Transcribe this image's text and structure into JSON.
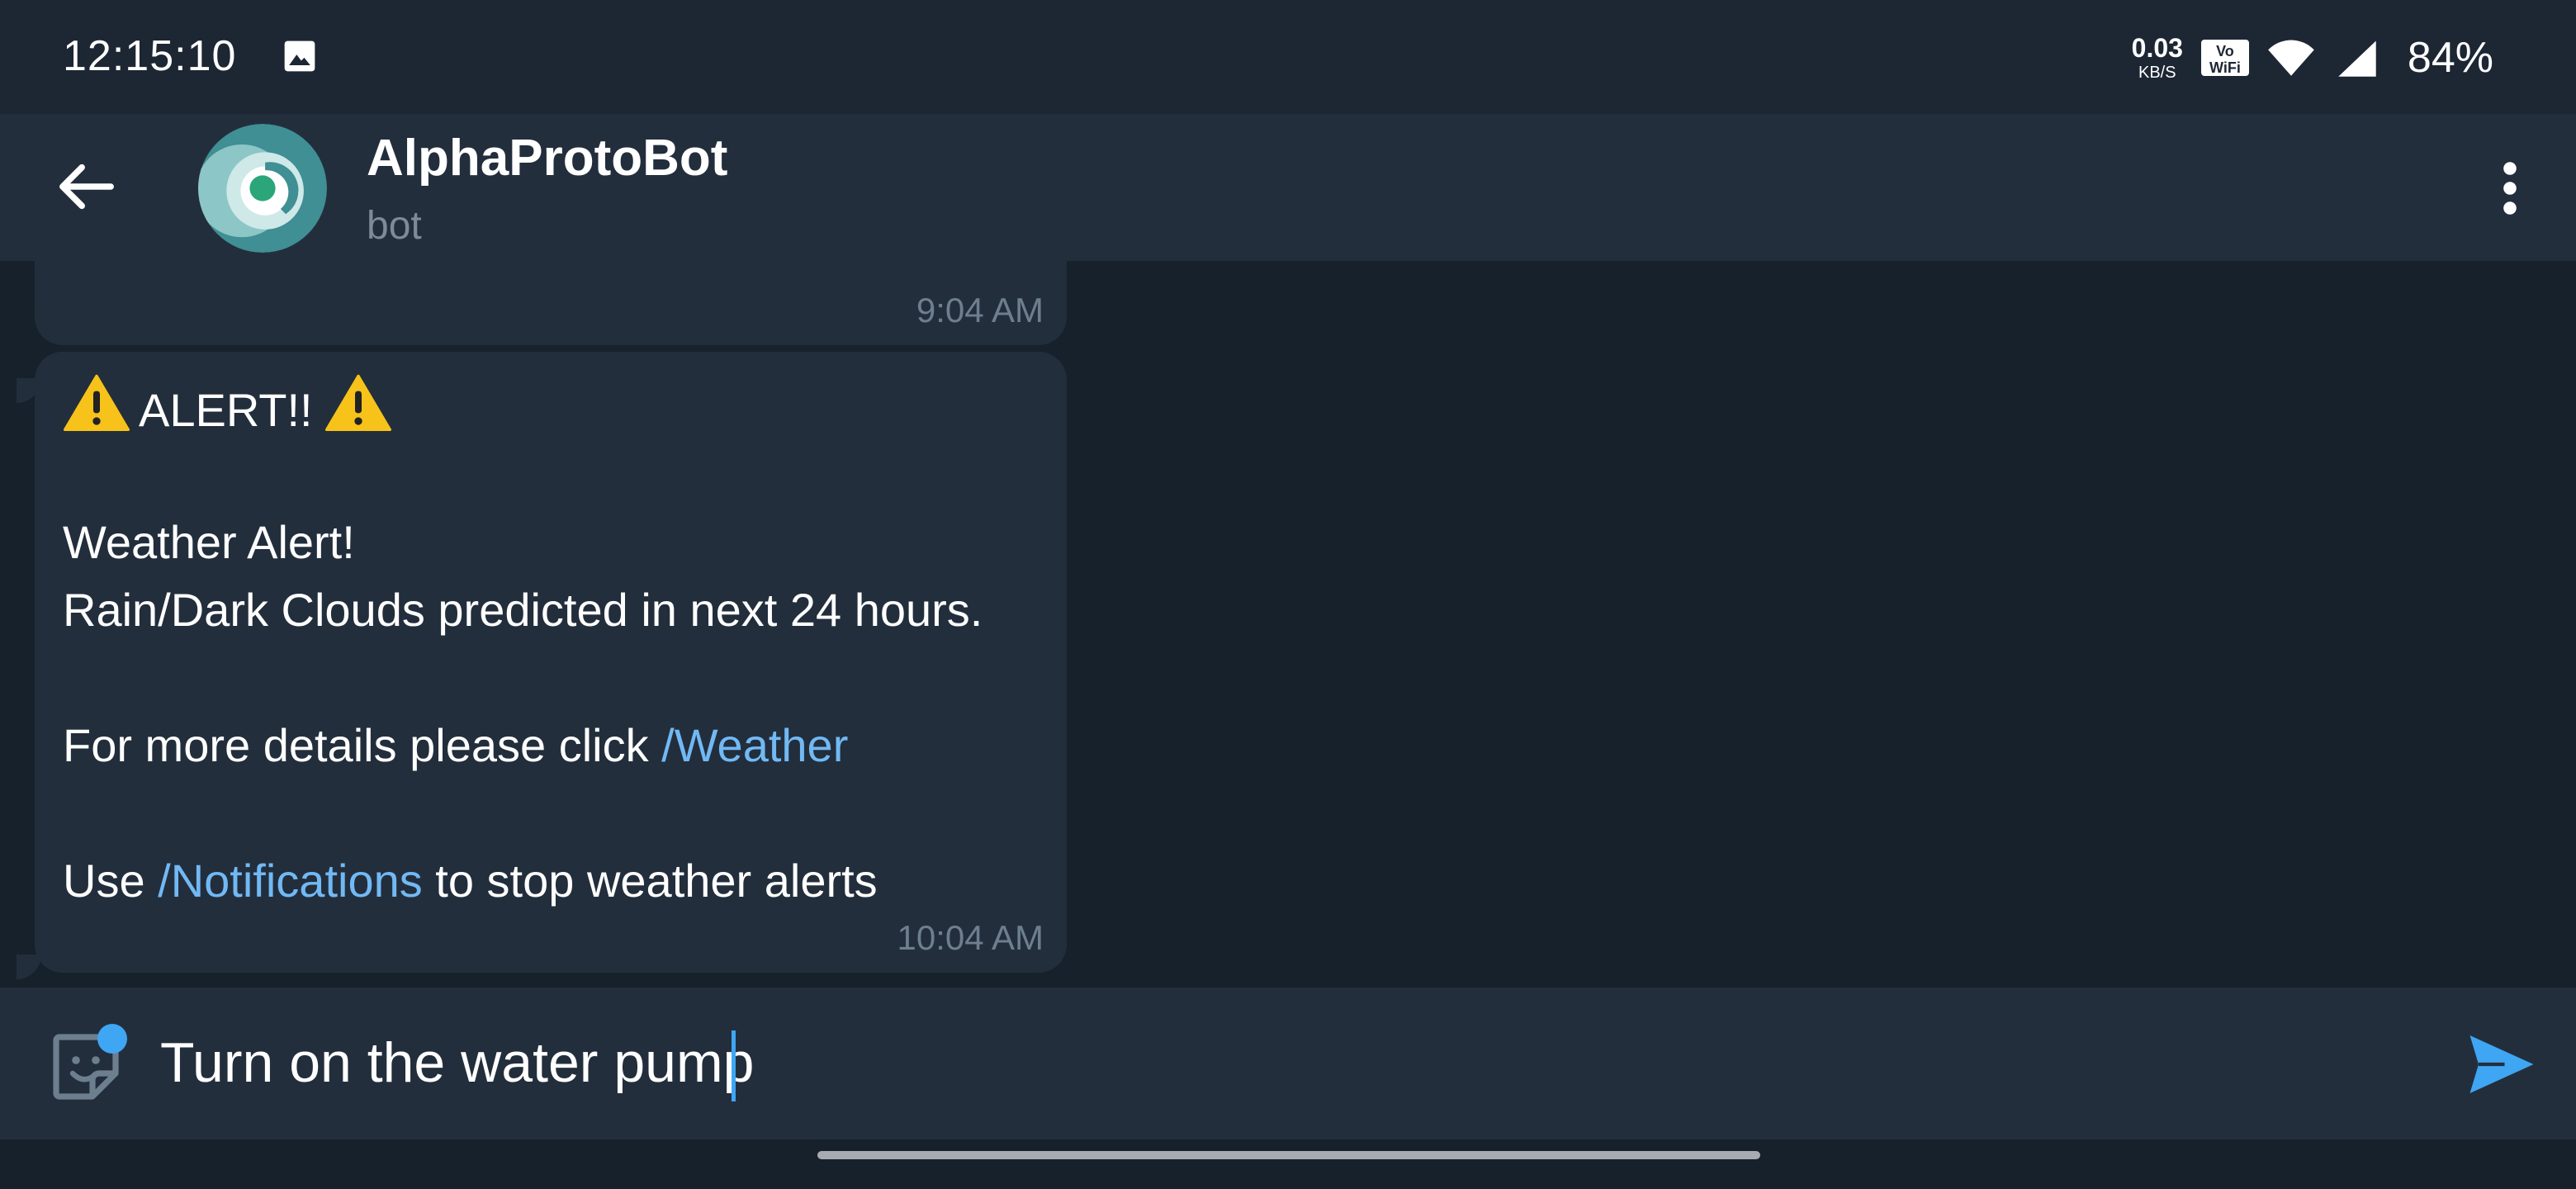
{
  "status_bar": {
    "time": "12:15:10",
    "net_speed_value": "0.03",
    "net_speed_unit": "KB/S",
    "vowifi_top": "Vo",
    "vowifi_bottom": "WiFi",
    "battery": "84%",
    "icons": [
      "gallery-icon",
      "vowifi-icon",
      "wifi-icon",
      "signal-icon"
    ]
  },
  "header": {
    "title": "AlphaProtoBot",
    "subtitle": "bot",
    "icons": [
      "back-arrow-icon",
      "more-vertical-icon"
    ]
  },
  "messages": [
    {
      "time": "9:04 AM"
    },
    {
      "alert_heading": "ALERT!!",
      "line_weather_alert": "Weather Alert!",
      "line_prediction": "Rain/Dark Clouds predicted in next 24 hours.",
      "line_details_prefix": "For more details please click ",
      "line_details_link": "/Weather",
      "line_use_prefix": "Use ",
      "line_use_link": "/Notifications",
      "line_use_suffix": " to stop weather alerts",
      "time": "10:04 AM"
    }
  ],
  "composer": {
    "text": "Turn on the water pump",
    "icons": [
      "sticker-icon",
      "send-icon"
    ]
  },
  "colors": {
    "background": "#17212b",
    "panel": "#232e3c",
    "link": "#71b9f4",
    "accent": "#3fa6f3",
    "muted": "#6d7f8f"
  }
}
